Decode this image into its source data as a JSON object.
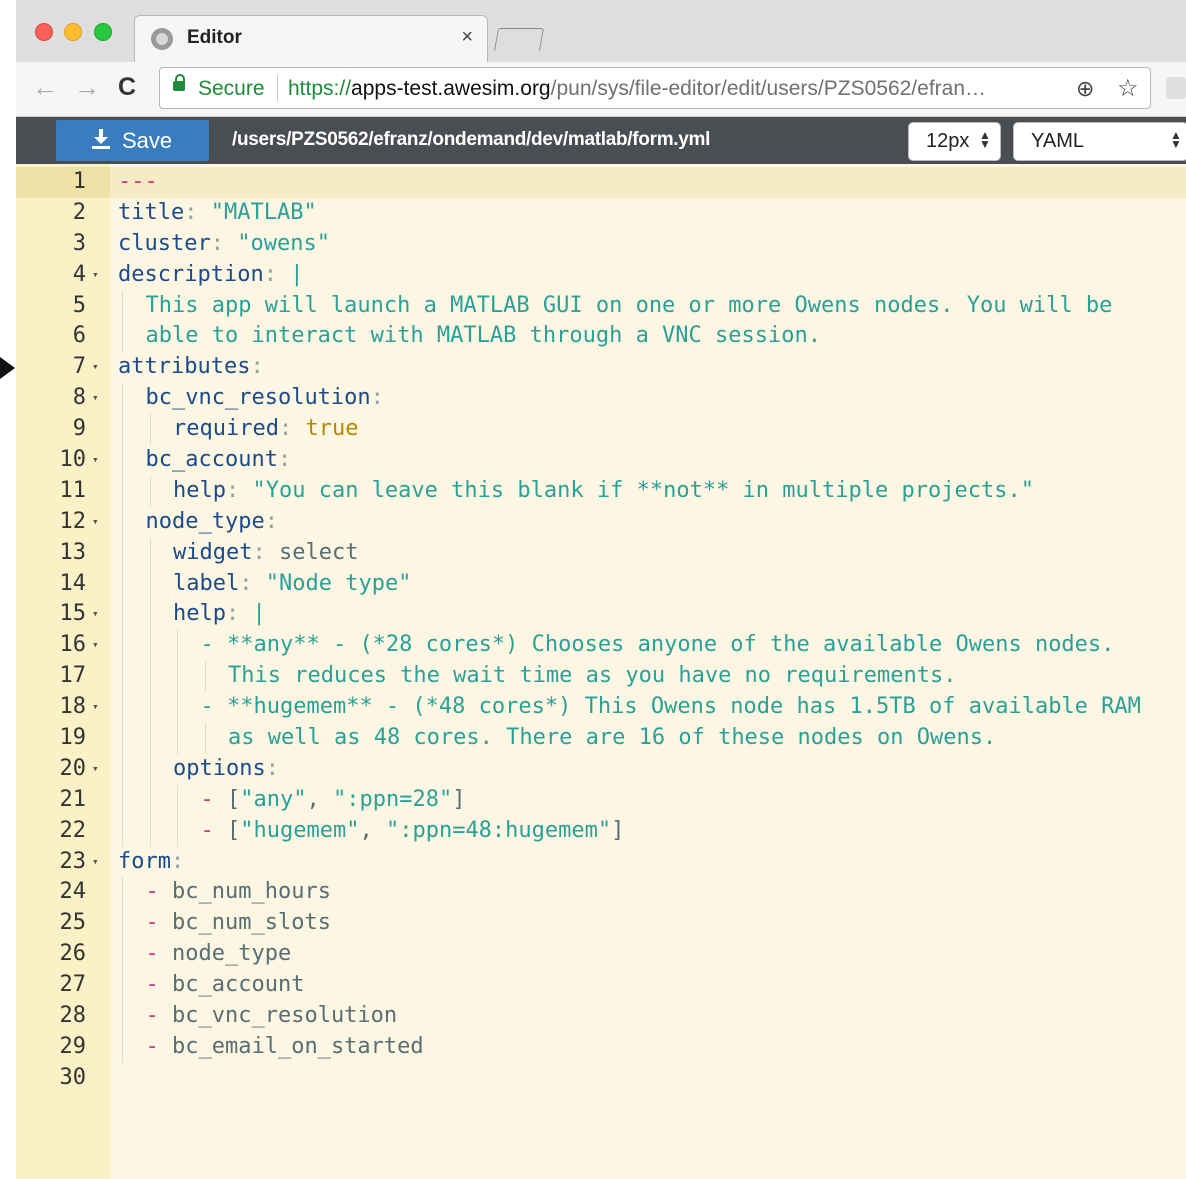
{
  "tab": {
    "title": "Editor",
    "close_glyph": "×"
  },
  "address": {
    "secure_label": "Secure",
    "url_scheme": "https://",
    "url_host": "apps-test.awesim.org",
    "url_path": "/pun/sys/file-editor/edit/users/PZS0562/efran…",
    "back_glyph": "←",
    "forward_glyph": "→",
    "reload_glyph": "C",
    "zoom_glyph": "⊕",
    "star_glyph": "☆"
  },
  "header": {
    "save_label": "Save",
    "file_path": "/users/PZS0562/efranz/ondemand/dev/matlab/form.yml",
    "font_size": "12px",
    "mode": "YAML"
  },
  "editor": {
    "active_line": 1,
    "lines": [
      {
        "n": "1",
        "fold": false,
        "indent": 0,
        "tokens": [
          [
            "dash",
            "---"
          ]
        ]
      },
      {
        "n": "2",
        "fold": false,
        "indent": 0,
        "tokens": [
          [
            "key",
            "title"
          ],
          [
            "punc",
            ": "
          ],
          [
            "str",
            "\"MATLAB\""
          ]
        ]
      },
      {
        "n": "3",
        "fold": false,
        "indent": 0,
        "tokens": [
          [
            "key",
            "cluster"
          ],
          [
            "punc",
            ": "
          ],
          [
            "str",
            "\"owens\""
          ]
        ]
      },
      {
        "n": "4",
        "fold": true,
        "indent": 0,
        "tokens": [
          [
            "key",
            "description"
          ],
          [
            "punc",
            ": "
          ],
          [
            "str",
            "|"
          ]
        ]
      },
      {
        "n": "5",
        "fold": false,
        "indent": 2,
        "tokens": [
          [
            "str",
            "This app will launch a MATLAB GUI on one or more Owens nodes. You will be"
          ]
        ]
      },
      {
        "n": "6",
        "fold": false,
        "indent": 2,
        "tokens": [
          [
            "str",
            "able to interact with MATLAB through a VNC session."
          ]
        ]
      },
      {
        "n": "7",
        "fold": true,
        "indent": 0,
        "tokens": [
          [
            "key",
            "attributes"
          ],
          [
            "punc",
            ":"
          ]
        ]
      },
      {
        "n": "8",
        "fold": true,
        "indent": 2,
        "tokens": [
          [
            "key",
            "bc_vnc_resolution"
          ],
          [
            "punc",
            ":"
          ]
        ]
      },
      {
        "n": "9",
        "fold": false,
        "indent": 4,
        "tokens": [
          [
            "key",
            "required"
          ],
          [
            "punc",
            ": "
          ],
          [
            "bool",
            "true"
          ]
        ]
      },
      {
        "n": "10",
        "fold": true,
        "indent": 2,
        "tokens": [
          [
            "key",
            "bc_account"
          ],
          [
            "punc",
            ":"
          ]
        ]
      },
      {
        "n": "11",
        "fold": false,
        "indent": 4,
        "tokens": [
          [
            "key",
            "help"
          ],
          [
            "punc",
            ": "
          ],
          [
            "str",
            "\"You can leave this blank if **not** in multiple projects.\""
          ]
        ]
      },
      {
        "n": "12",
        "fold": true,
        "indent": 2,
        "tokens": [
          [
            "key",
            "node_type"
          ],
          [
            "punc",
            ":"
          ]
        ]
      },
      {
        "n": "13",
        "fold": false,
        "indent": 4,
        "tokens": [
          [
            "key",
            "widget"
          ],
          [
            "punc",
            ": "
          ],
          [
            "plain",
            "select"
          ]
        ]
      },
      {
        "n": "14",
        "fold": false,
        "indent": 4,
        "tokens": [
          [
            "key",
            "label"
          ],
          [
            "punc",
            ": "
          ],
          [
            "str",
            "\"Node type\""
          ]
        ]
      },
      {
        "n": "15",
        "fold": true,
        "indent": 4,
        "tokens": [
          [
            "key",
            "help"
          ],
          [
            "punc",
            ": "
          ],
          [
            "str",
            "|"
          ]
        ]
      },
      {
        "n": "16",
        "fold": true,
        "indent": 6,
        "tokens": [
          [
            "str",
            "- **any** - (*28 cores*) Chooses anyone of the available Owens nodes."
          ]
        ]
      },
      {
        "n": "17",
        "fold": false,
        "indent": 8,
        "tokens": [
          [
            "str",
            "This reduces the wait time as you have no requirements."
          ]
        ]
      },
      {
        "n": "18",
        "fold": true,
        "indent": 6,
        "tokens": [
          [
            "str",
            "- **hugemem** - (*48 cores*) This Owens node has 1.5TB of available RAM"
          ]
        ]
      },
      {
        "n": "19",
        "fold": false,
        "indent": 8,
        "tokens": [
          [
            "str",
            "as well as 48 cores. There are 16 of these nodes on Owens."
          ]
        ]
      },
      {
        "n": "20",
        "fold": true,
        "indent": 4,
        "tokens": [
          [
            "key",
            "options"
          ],
          [
            "punc",
            ":"
          ]
        ]
      },
      {
        "n": "21",
        "fold": false,
        "indent": 6,
        "tokens": [
          [
            "dash",
            "- "
          ],
          [
            "plain",
            "["
          ],
          [
            "str",
            "\"any\""
          ],
          [
            "plain",
            ", "
          ],
          [
            "str",
            "\":ppn=28\""
          ],
          [
            "plain",
            "]"
          ]
        ]
      },
      {
        "n": "22",
        "fold": false,
        "indent": 6,
        "tokens": [
          [
            "dash",
            "- "
          ],
          [
            "plain",
            "["
          ],
          [
            "str",
            "\"hugemem\""
          ],
          [
            "plain",
            ", "
          ],
          [
            "str",
            "\":ppn=48:hugemem\""
          ],
          [
            "plain",
            "]"
          ]
        ]
      },
      {
        "n": "23",
        "fold": true,
        "indent": 0,
        "tokens": [
          [
            "key",
            "form"
          ],
          [
            "punc",
            ":"
          ]
        ]
      },
      {
        "n": "24",
        "fold": false,
        "indent": 2,
        "tokens": [
          [
            "dash",
            "- "
          ],
          [
            "plain",
            "bc_num_hours"
          ]
        ]
      },
      {
        "n": "25",
        "fold": false,
        "indent": 2,
        "tokens": [
          [
            "dash",
            "- "
          ],
          [
            "plain",
            "bc_num_slots"
          ]
        ]
      },
      {
        "n": "26",
        "fold": false,
        "indent": 2,
        "tokens": [
          [
            "dash",
            "- "
          ],
          [
            "plain",
            "node_type"
          ]
        ]
      },
      {
        "n": "27",
        "fold": false,
        "indent": 2,
        "tokens": [
          [
            "dash",
            "- "
          ],
          [
            "plain",
            "bc_account"
          ]
        ]
      },
      {
        "n": "28",
        "fold": false,
        "indent": 2,
        "tokens": [
          [
            "dash",
            "- "
          ],
          [
            "plain",
            "bc_vnc_resolution"
          ]
        ]
      },
      {
        "n": "29",
        "fold": false,
        "indent": 2,
        "tokens": [
          [
            "dash",
            "- "
          ],
          [
            "plain",
            "bc_email_on_started"
          ]
        ]
      },
      {
        "n": "30",
        "fold": false,
        "indent": 0,
        "tokens": []
      }
    ]
  }
}
